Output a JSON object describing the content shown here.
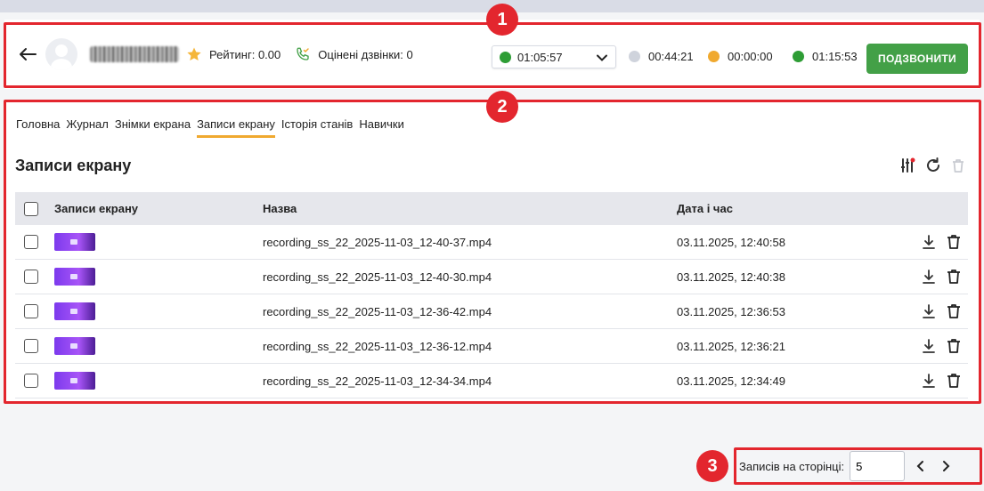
{
  "header": {
    "rating_label": "Рейтинг: 0.00",
    "rated_calls_label": "Оцінені дзвінки: 0",
    "timer_select": {
      "value": "01:05:57",
      "color": "#2e9d35"
    },
    "stats": [
      {
        "value": "00:44:21",
        "color": "#cfd3dc"
      },
      {
        "value": "00:00:00",
        "color": "#f0a92f"
      },
      {
        "value": "01:15:53",
        "color": "#2e9d35"
      }
    ],
    "call_button": "ПОДЗВОНИТИ"
  },
  "tabs": [
    {
      "label": "Головна",
      "active": false
    },
    {
      "label": "Журнал",
      "active": false
    },
    {
      "label": "Знімки екрана",
      "active": false
    },
    {
      "label": "Записи екрану",
      "active": true
    },
    {
      "label": "Історія станів",
      "active": false
    },
    {
      "label": "Навички",
      "active": false
    }
  ],
  "section_title": "Записи екрану",
  "table": {
    "columns": [
      "Записи екрану",
      "Назва",
      "Дата і час"
    ],
    "rows": [
      {
        "name": "recording_ss_22_2025-11-03_12-40-37.mp4",
        "datetime": "03.11.2025, 12:40:58"
      },
      {
        "name": "recording_ss_22_2025-11-03_12-40-30.mp4",
        "datetime": "03.11.2025, 12:40:38"
      },
      {
        "name": "recording_ss_22_2025-11-03_12-36-42.mp4",
        "datetime": "03.11.2025, 12:36:53"
      },
      {
        "name": "recording_ss_22_2025-11-03_12-36-12.mp4",
        "datetime": "03.11.2025, 12:36:21"
      },
      {
        "name": "recording_ss_22_2025-11-03_12-34-34.mp4",
        "datetime": "03.11.2025, 12:34:49"
      }
    ]
  },
  "pagination": {
    "label": "Записів на сторінці:",
    "per_page": "5"
  },
  "annotations": [
    "1",
    "2",
    "3"
  ],
  "colors": {
    "accent_tab": "#f0a92f",
    "call_button": "#43a047",
    "annotation": "#e3262e"
  }
}
